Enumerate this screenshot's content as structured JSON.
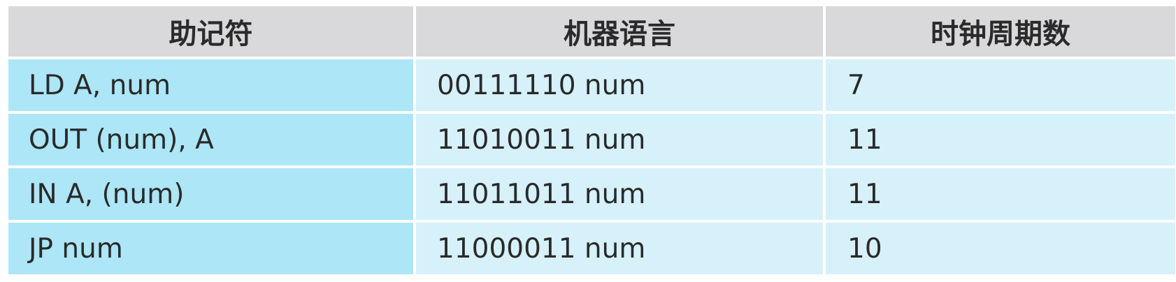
{
  "table": {
    "headers": [
      "助记符",
      "机器语言",
      "时钟周期数"
    ],
    "rows": [
      {
        "mnemonic": "LD A, num",
        "machine_code": "00111110 num",
        "clock_cycles": "7"
      },
      {
        "mnemonic": "OUT (num), A",
        "machine_code": "11010011 num",
        "clock_cycles": "11"
      },
      {
        "mnemonic": "IN A, (num)",
        "machine_code": "11011011 num",
        "clock_cycles": "11"
      },
      {
        "mnemonic": "JP num",
        "machine_code": "11000011 num",
        "clock_cycles": "10"
      }
    ],
    "colors": {
      "header_bg": "#d9d9db",
      "first_col_bg": "#ace6f7",
      "other_col_bg": "#d6f1fa"
    }
  }
}
